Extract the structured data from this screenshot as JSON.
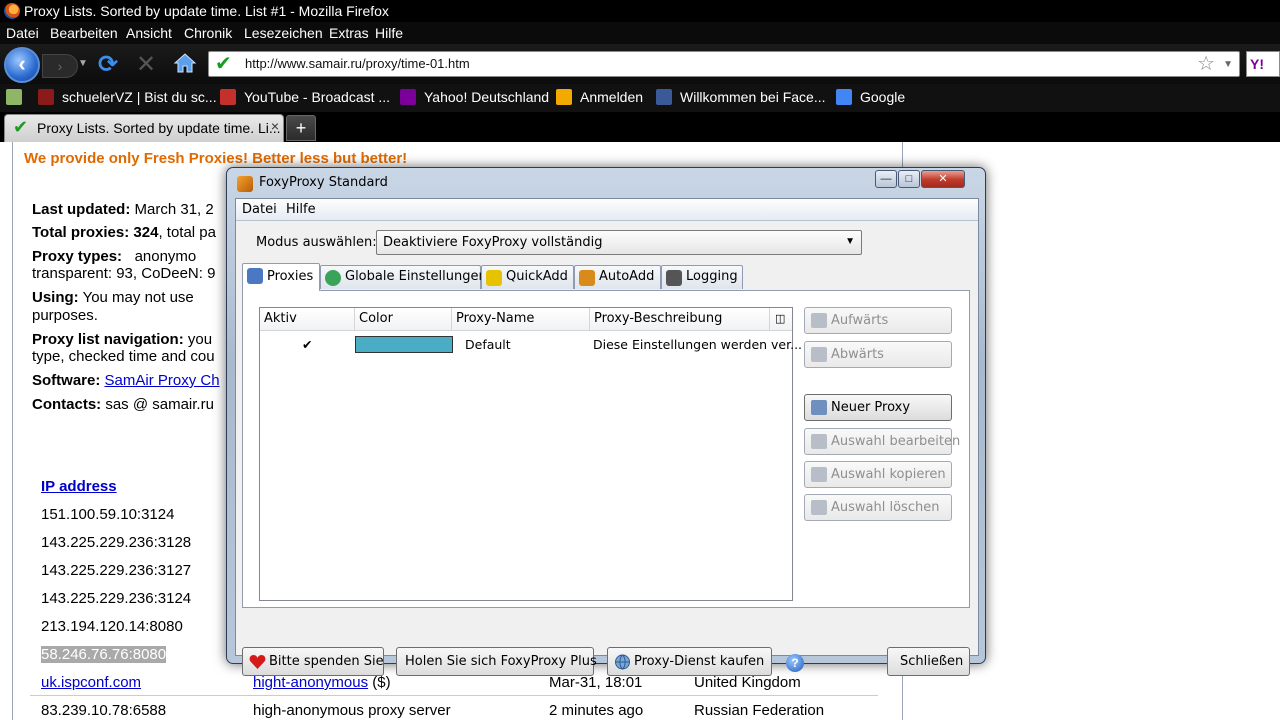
{
  "window": {
    "title": "Proxy Lists. Sorted by update time. List #1 - Mozilla Firefox"
  },
  "menubar": [
    "Datei",
    "Bearbeiten",
    "Ansicht",
    "Chronik",
    "Lesezeichen",
    "Extras",
    "Hilfe"
  ],
  "nav": {
    "url": "http://www.samair.ru/proxy/time-01.htm",
    "search_engine": "Y!"
  },
  "bookmarks": [
    {
      "label": "schuelerVZ | Bist du sc...",
      "icon": "schuelervz-icon",
      "color": "#8b1a1a"
    },
    {
      "label": "YouTube - Broadcast ...",
      "icon": "youtube-icon",
      "color": "#c4302b"
    },
    {
      "label": "Yahoo! Deutschland",
      "icon": "yahoo-icon",
      "color": "#7b0099"
    },
    {
      "label": "Anmelden",
      "icon": "windows-live-icon",
      "color": "#f2a900"
    },
    {
      "label": "Willkommen bei Face...",
      "icon": "facebook-icon",
      "color": "#3b5998"
    },
    {
      "label": "Google",
      "icon": "google-icon",
      "color": "#4285f4"
    }
  ],
  "tab": {
    "label": "Proxy Lists. Sorted by update time. Li...",
    "close": "×",
    "new": "+"
  },
  "page": {
    "headline": "We provide only Fresh Proxies! Better less but better!",
    "last_updated_label": "Last updated:",
    "last_updated_value": "March 31, 2",
    "total_label": "Total proxies:",
    "total_value": "324",
    "total_tail": ", total pa",
    "types_label": "Proxy types:",
    "types_value": "anonymo",
    "types_line2": "transparent: 93, CoDeeN: 9",
    "using_label": "Using:",
    "using_value": "You may not use",
    "using_line2": "purposes.",
    "nav_label": "Proxy list navigation:",
    "nav_value": "you",
    "nav_line2": "type, checked time and cou",
    "software_label": "Software:",
    "software_link": "SamAir Proxy Ch",
    "contacts_label": "Contacts:",
    "contacts_value": "sas @ samair.ru",
    "ip_header": "IP address",
    "ips": [
      "151.100.59.10:3124",
      "143.225.229.236:3128",
      "143.225.229.236:3127",
      "143.225.229.236:3124",
      "213.194.120.14:8080",
      "58.246.76.76:8080"
    ],
    "row_host": "uk.ispconf.com",
    "row_type_link": "hight-anonymous",
    "row_type_tail": "($)",
    "row_time": "Mar-31, 18:01",
    "row_country": "United Kingdom",
    "row2_ip": "83.239.10.78:6588",
    "row2_type": "high-anonymous proxy server",
    "row2_time": "2 minutes ago",
    "row2_country": "Russian Federation"
  },
  "dialog": {
    "title": "FoxyProxy Standard",
    "menu": [
      "Datei",
      "Hilfe"
    ],
    "mode_label": "Modus auswählen:",
    "mode_value": "Deaktiviere FoxyProxy vollständig",
    "tabs": [
      {
        "label": "Proxies",
        "icon": "proxies-icon",
        "color": "#4a78c2"
      },
      {
        "label": "Globale Einstellungen",
        "icon": "globe-icon",
        "color": "#3aa35a"
      },
      {
        "label": "QuickAdd",
        "icon": "lightning-icon",
        "color": "#e6c200"
      },
      {
        "label": "AutoAdd",
        "icon": "wand-icon",
        "color": "#d88b1a"
      },
      {
        "label": "Logging",
        "icon": "list-icon",
        "color": "#555555"
      }
    ],
    "columns": [
      "Aktiv",
      "Color",
      "Proxy-Name",
      "Proxy-Beschreibung"
    ],
    "rows": [
      {
        "active": "✔",
        "color": "#4bacc6",
        "name": "Default",
        "description": "Diese Einstellungen werden ver..."
      }
    ],
    "side_buttons": [
      "Aufwärts",
      "Abwärts",
      "Neuer Proxy",
      "Auswahl bearbeiten",
      "Auswahl kopieren",
      "Auswahl löschen"
    ],
    "bottom_buttons": [
      "Bitte spenden Sie",
      "Holen Sie sich FoxyProxy Plus",
      "Proxy-Dienst kaufen",
      "Schließen"
    ]
  }
}
